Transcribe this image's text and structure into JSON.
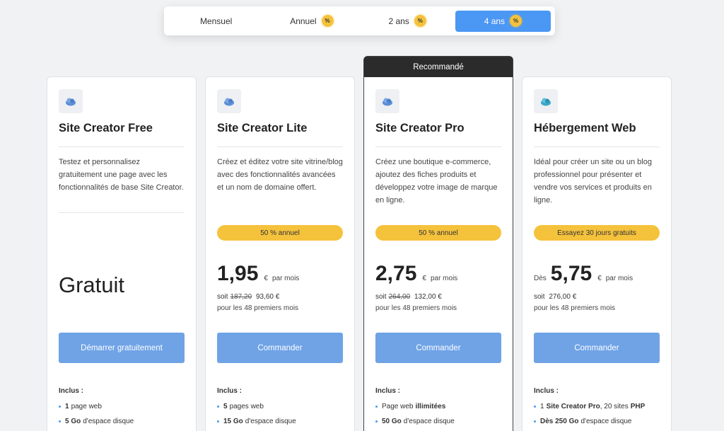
{
  "periods": [
    {
      "label": "Mensuel",
      "badge": "",
      "active": false
    },
    {
      "label": "Annuel",
      "badge": "%",
      "active": false
    },
    {
      "label": "2 ans",
      "badge": "%",
      "active": false
    },
    {
      "label": "4 ans",
      "badge": "%",
      "active": true
    }
  ],
  "recommended_label": "Recommandé",
  "colors": {
    "accent": "#4b97f4",
    "promo": "#f5c23c",
    "cta": "#6fa3e6"
  },
  "plans": [
    {
      "name": "Site Creator Free",
      "icon": "cloud-icon",
      "description": "Testez et personnalisez gratuitement une page avec les fonctionnalités de base Site Creator.",
      "price_text": "Gratuit",
      "cta": "Démarrer gratuitement",
      "included_title": "Inclus :",
      "features": [
        {
          "strong": "1",
          "rest": "page web"
        },
        {
          "strong": "5 Go",
          "rest": "d'espace disque"
        }
      ]
    },
    {
      "name": "Site Creator Lite",
      "icon": "cloud-icon",
      "description": "Créez et éditez votre site vitrine/blog avec des fonctionnalités avancées et un nom de domaine offert.",
      "promo": "50 % annuel",
      "price": "1,95",
      "currency": "€",
      "unit": "par mois",
      "soit": "soit",
      "old_total": "187,20",
      "new_total": "93,60 €",
      "duration": "pour les 48 premiers mois",
      "cta": "Commander",
      "included_title": "Inclus :",
      "features": [
        {
          "strong": "5",
          "rest": "pages web"
        },
        {
          "strong": "15 Go",
          "rest": "d'espace disque"
        }
      ]
    },
    {
      "name": "Site Creator Pro",
      "icon": "cloud-icon",
      "description": "Créez une boutique e-commerce, ajoutez des fiches produits et développez votre image de marque en ligne.",
      "promo": "50 % annuel",
      "price": "2,75",
      "currency": "€",
      "unit": "par mois",
      "soit": "soit",
      "old_total": "264,00",
      "new_total": "132,00 €",
      "duration": "pour les 48 premiers mois",
      "cta": "Commander",
      "included_title": "Inclus :",
      "features": [
        {
          "pre": "Page web",
          "strong": "illimitées",
          "rest": ""
        },
        {
          "strong": "50 Go",
          "rest": "d'espace disque"
        }
      ]
    },
    {
      "name": "Hébergement Web",
      "icon": "cloud-icon",
      "description": "Idéal pour créer un site ou un blog professionnel pour présenter et vendre vos services et produits en ligne.",
      "promo": "Essayez 30 jours gratuits",
      "price_prefix": "Dès",
      "price": "5,75",
      "currency": "€",
      "unit": "par mois",
      "soit": "soit",
      "new_total": "276,00 €",
      "duration": "pour les 48 premiers mois",
      "cta": "Commander",
      "included_title": "Inclus :",
      "features": [
        {
          "pre": "1",
          "strong": "Site Creator Pro",
          "rest": ", 20 sites",
          "strong2": "PHP"
        },
        {
          "strong": "Dès 250 Go",
          "rest": "d'espace disque"
        }
      ]
    }
  ]
}
